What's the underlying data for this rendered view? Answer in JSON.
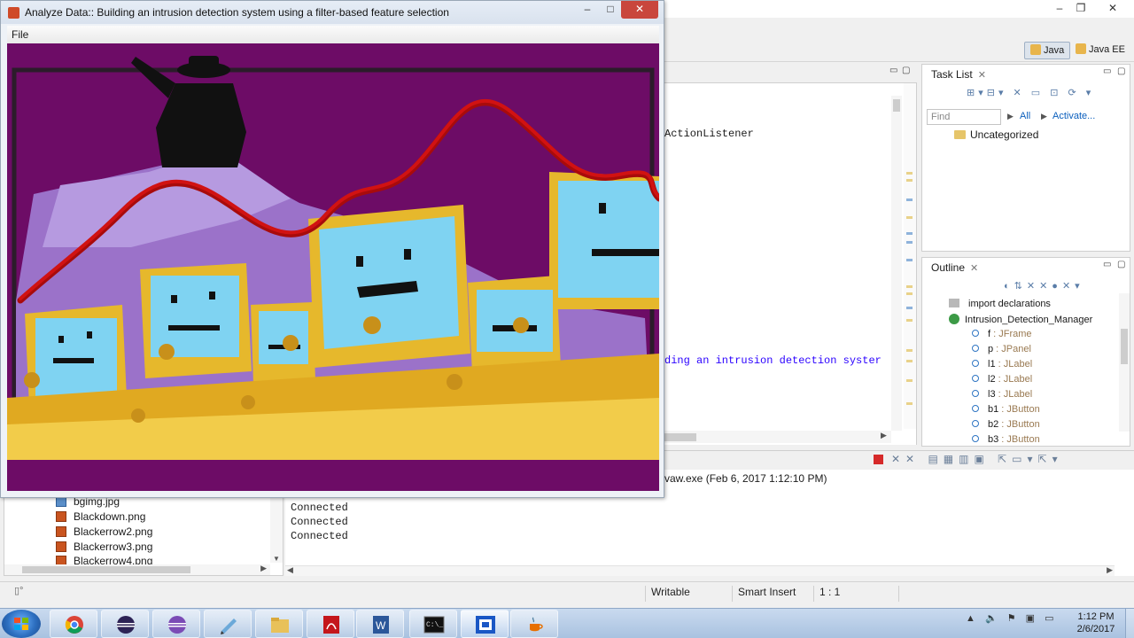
{
  "app_window": {
    "title": "Analyze Data:: Building an intrusion detection system using a filter-based feature selection",
    "menu": {
      "file": "File"
    },
    "controls": {
      "minimize": "–",
      "maximize": "□",
      "close": "✕"
    }
  },
  "ide": {
    "perspectives": {
      "java": "Java",
      "java_ee": "Java EE"
    },
    "editor": {
      "code_line_1": "ActionListener",
      "code_line_2": "ding an intrusion detection syster"
    },
    "task_list": {
      "tab": "Task List",
      "find_placeholder": "Find",
      "all": "All",
      "activate": "Activate...",
      "category": "Uncategorized"
    },
    "outline": {
      "tab": "Outline",
      "items": [
        {
          "name": "import declarations",
          "type": ""
        },
        {
          "name": "Intrusion_Detection_Manager",
          "type": ""
        },
        {
          "name": "f",
          "type": " : JFrame"
        },
        {
          "name": "p",
          "type": " : JPanel"
        },
        {
          "name": "l1",
          "type": " : JLabel"
        },
        {
          "name": "l2",
          "type": " : JLabel"
        },
        {
          "name": "l3",
          "type": " : JLabel"
        },
        {
          "name": "b1",
          "type": " : JButton"
        },
        {
          "name": "b2",
          "type": " : JButton"
        },
        {
          "name": "b3",
          "type": " : JButton"
        }
      ]
    },
    "console": {
      "header": "vaw.exe (Feb 6, 2017 1:12:10 PM)",
      "lines": [
        "Connected",
        "Connected",
        "Connected"
      ]
    },
    "explorer": {
      "files": [
        "bgimg.jpg",
        "Blackdown.png",
        "Blackerrow2.png",
        "Blackerrow3.png",
        "Blackerrow4.png"
      ]
    },
    "statusbar": {
      "writable": "Writable",
      "insert_mode": "Smart Insert",
      "position": "1 : 1"
    }
  },
  "taskbar": {
    "items": [
      "chrome",
      "eclipse",
      "eclipse-alt",
      "edit",
      "explorer",
      "pdf",
      "word",
      "cmd",
      "app",
      "java"
    ],
    "clock_time": "1:12 PM",
    "clock_date": "2/6/2017"
  },
  "colors": {
    "canvas_purple": "#6d0c66",
    "trend_red": "#d11212",
    "screen_blue": "#7fd3f2",
    "body_gold": "#e6b82c",
    "cube_lilac": "#9b72c9"
  }
}
